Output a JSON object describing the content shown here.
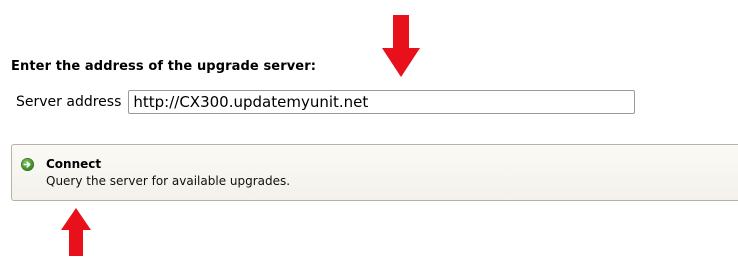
{
  "upgrade_server": {
    "heading": "Enter the address of the upgrade server:",
    "field_label": "Server address",
    "field_value": "http://CX300.updatemyunit.net"
  },
  "connect_action": {
    "title": "Connect",
    "description": "Query the server for available upgrades.",
    "icon": "arrow-right-circle-icon"
  },
  "annotations": {
    "arrow_color": "#e8101a"
  }
}
